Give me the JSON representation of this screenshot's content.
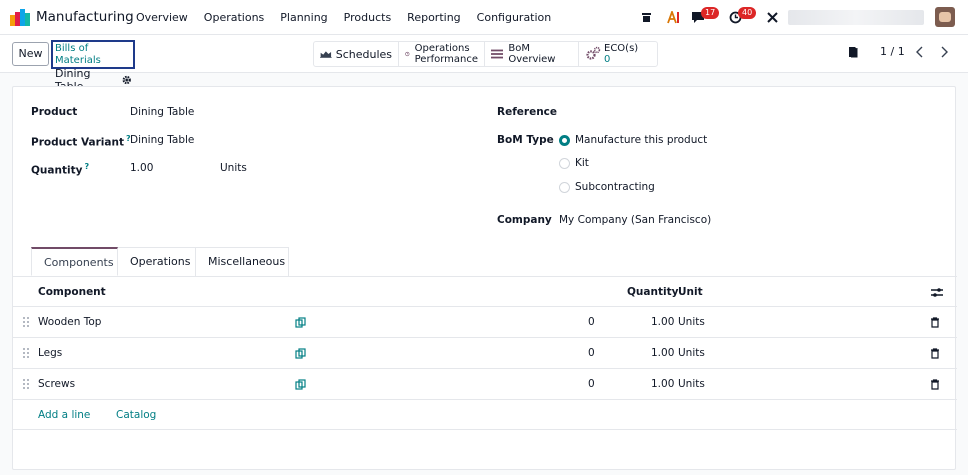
{
  "navbar": {
    "app_name": "Manufacturing",
    "menu": [
      "Overview",
      "Operations",
      "Planning",
      "Products",
      "Reporting",
      "Configuration"
    ],
    "messages_badge": "17",
    "activities_badge": "40"
  },
  "control_panel": {
    "new_label": "New",
    "breadcrumb_parent": "Bills of Materials",
    "breadcrumb_current": "Dining Table",
    "smart_buttons": {
      "schedules": "Schedules",
      "operations_performance_line1": "Operations",
      "operations_performance_line2": "Performance",
      "bom_overview": "BoM Overview",
      "ecos_label": "ECO(s)",
      "ecos_count": "0"
    },
    "pager": "1 / 1"
  },
  "form": {
    "product_label": "Product",
    "product_value": "Dining Table",
    "variant_label": "Product Variant",
    "variant_value": "Dining Table",
    "quantity_label": "Quantity",
    "quantity_value": "1.00",
    "quantity_unit": "Units",
    "help_mark": "?",
    "reference_label": "Reference",
    "bom_type_label": "BoM Type",
    "bom_type_options": [
      "Manufacture this product",
      "Kit",
      "Subcontracting"
    ],
    "company_label": "Company",
    "company_value": "My Company (San Francisco)"
  },
  "tabs": [
    "Components",
    "Operations",
    "Miscellaneous"
  ],
  "components_table": {
    "headers": {
      "component": "Component",
      "quantity": "Quantity",
      "unit": "Unit"
    },
    "rows": [
      {
        "component": "Wooden Top",
        "count": "0",
        "quantity": "1.00",
        "unit": "Units"
      },
      {
        "component": "Legs",
        "count": "0",
        "quantity": "1.00",
        "unit": "Units"
      },
      {
        "component": "Screws",
        "count": "0",
        "quantity": "1.00",
        "unit": "Units"
      }
    ],
    "add_line": "Add a line",
    "catalog": "Catalog"
  },
  "colors": {
    "accent": "#017e84",
    "brand": "#714b67",
    "badge": "#dc2626"
  }
}
